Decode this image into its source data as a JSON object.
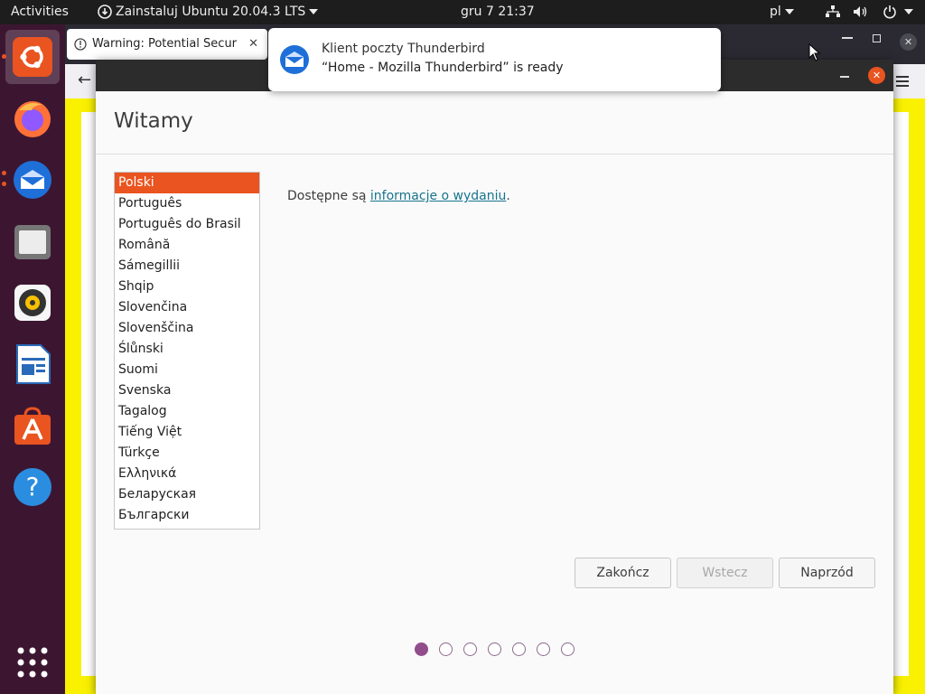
{
  "topbar": {
    "activities": "Activities",
    "app_menu": "Zainstaluj Ubuntu 20.04.3 LTS",
    "clock": "gru 7  21:37",
    "keyboard_layout": "pl"
  },
  "dock": {
    "items": [
      "ubuntu-installer",
      "firefox",
      "thunderbird",
      "files",
      "rhythmbox",
      "libreoffice-writer",
      "ubuntu-software",
      "help",
      "show-applications"
    ]
  },
  "browser": {
    "tab_title": "Warning: Potential Secur"
  },
  "notification": {
    "title": "Klient poczty Thunderbird",
    "body": "“Home - Mozilla Thunderbird” is ready"
  },
  "installer": {
    "title": "Witamy",
    "languages": [
      "Polski",
      "Português",
      "Português do Brasil",
      "Română",
      "Sámegillii",
      "Shqip",
      "Slovenčina",
      "Slovenščina",
      "Ślůnski",
      "Suomi",
      "Svenska",
      "Tagalog",
      "Tiếng Việt",
      "Türkçe",
      "Ελληνικά",
      "Беларуская",
      "Български"
    ],
    "selected_language": "Polski",
    "release_prefix": "Dostępne są ",
    "release_link": "informacje o wydaniu",
    "release_suffix": ".",
    "buttons": {
      "quit": "Zakończ",
      "back": "Wstecz",
      "forward": "Naprzód"
    },
    "steps_total": 7,
    "current_step": 1
  },
  "colors": {
    "accent": "#e95420",
    "step_dot": "#924d8b",
    "link": "#17748e",
    "browser_page_bg": "#f9f100"
  }
}
